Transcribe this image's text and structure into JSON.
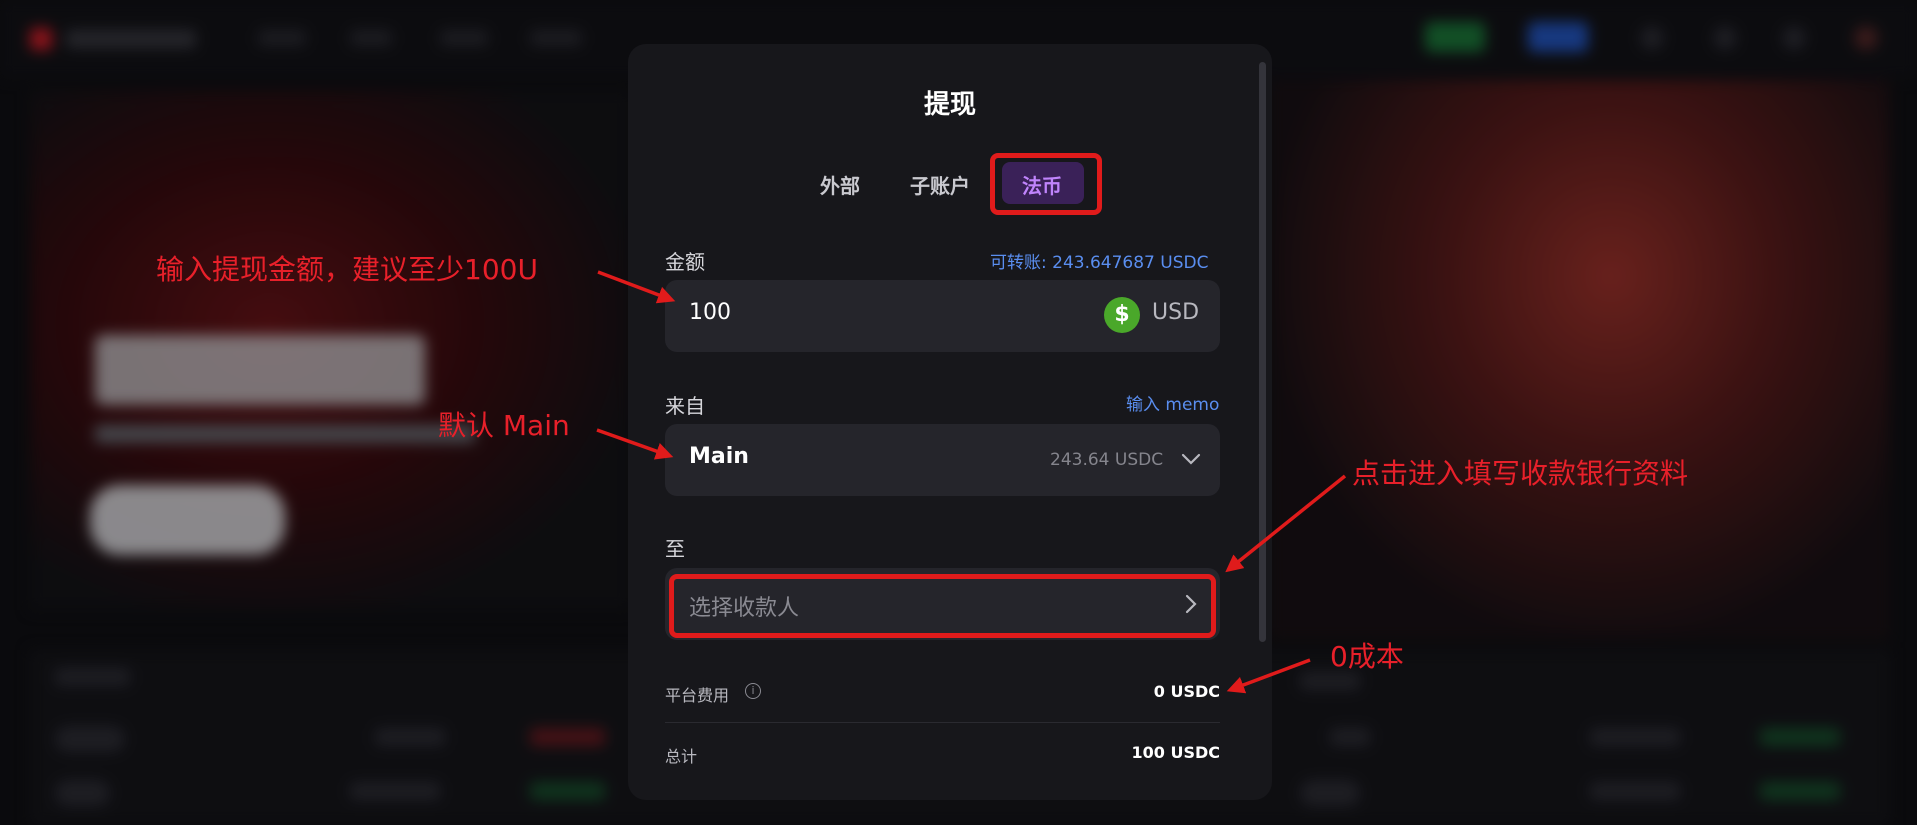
{
  "modal": {
    "title": "提现",
    "tabs": [
      {
        "label": "外部"
      },
      {
        "label": "子账户"
      },
      {
        "label": "法币"
      }
    ],
    "amount": {
      "label": "金额",
      "available": "可转账: 243.647687 USDC",
      "value": "100",
      "currency_icon": "$",
      "currency": "USD"
    },
    "from": {
      "label": "来自",
      "memo_link": "输入 memo",
      "account": "Main",
      "balance": "243.64 USDC"
    },
    "to": {
      "label": "至",
      "placeholder": "选择收款人"
    },
    "fee": {
      "label": "平台费用",
      "info_glyph": "i",
      "value": "0 USDC"
    },
    "total": {
      "label": "总计",
      "value": "100 USDC"
    }
  },
  "annotations": {
    "amount_note": "输入提现金额，建议至少100U",
    "from_note": "默认 Main",
    "payee_note": "点击进入填写收款银行资料",
    "fee_note": "0成本",
    "color": "#e8202a"
  },
  "colors": {
    "tab_active_bg": "#3a2158",
    "tab_active_text": "#c084fc",
    "link": "#5a8ef0",
    "usd_icon": "#4aa82a"
  }
}
